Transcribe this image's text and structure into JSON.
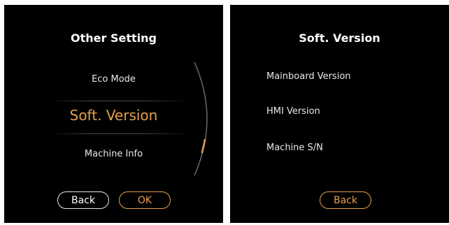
{
  "left_screen": {
    "title": "Other Setting",
    "menu": {
      "items": [
        {
          "label": "Eco Mode"
        },
        {
          "label": "Soft. Version"
        },
        {
          "label": "Machine Info"
        }
      ],
      "selected_index": 1
    },
    "buttons": {
      "back_label": "Back",
      "ok_label": "OK"
    }
  },
  "right_screen": {
    "title": "Soft. Version",
    "items": [
      {
        "label": "Mainboard Version"
      },
      {
        "label": "HMI Version"
      },
      {
        "label": "Machine S/N"
      }
    ],
    "buttons": {
      "back_label": "Back"
    }
  },
  "colors": {
    "background": "#000000",
    "accent": "#e6a04a",
    "text": "#e8e8e8",
    "divider": "#4a4a4a"
  }
}
